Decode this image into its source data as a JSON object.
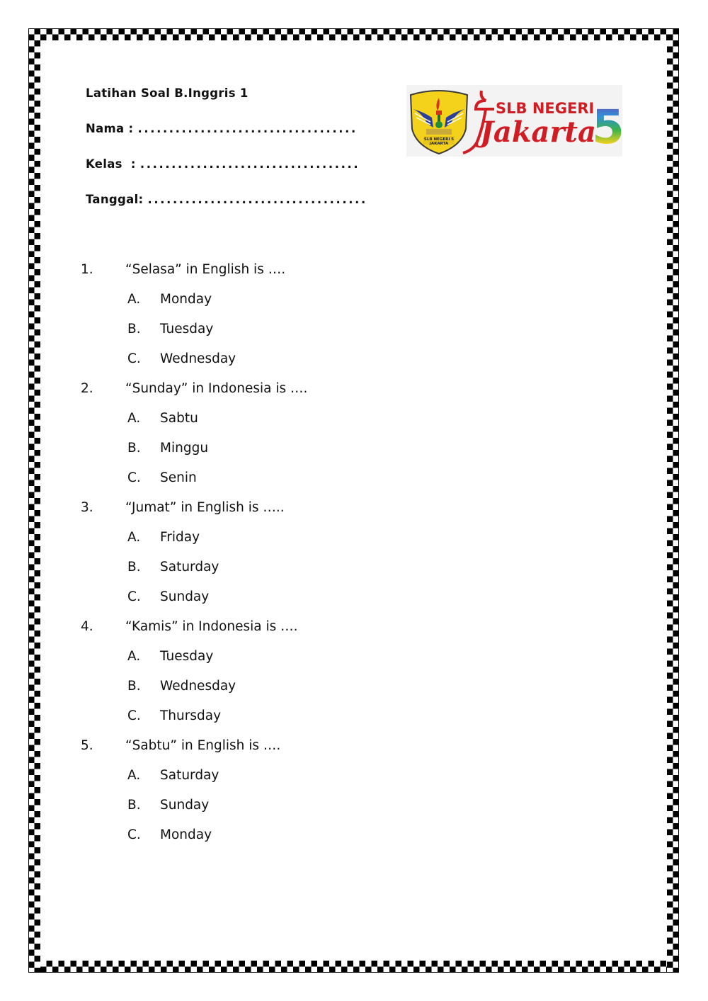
{
  "document": {
    "title": "Latihan Soal B.Inggris 1",
    "fields": [
      {
        "label": "Nama :",
        "blank": "..................................."
      },
      {
        "label": "Kelas  :",
        "blank": "..................................."
      },
      {
        "label": "Tanggal:",
        "blank": "..................................."
      }
    ],
    "logo": {
      "line1": "SLB NEGERI",
      "line2": "Jakarta",
      "number": "5",
      "shield_text": [
        "SLB NEGERI 5",
        "JAKARTA"
      ],
      "colors": {
        "red": "#d01c23",
        "shield_yellow": "#f4d21c",
        "wing_blue": "#2a3f9a"
      }
    }
  },
  "questions": [
    {
      "number": "1.",
      "text": "“Selasa” in English is ….",
      "options": [
        {
          "letter": "A.",
          "text": "Monday"
        },
        {
          "letter": "B.",
          "text": "Tuesday"
        },
        {
          "letter": "C.",
          "text": "Wednesday"
        }
      ]
    },
    {
      "number": "2.",
      "text": "“Sunday” in Indonesia is ….",
      "options": [
        {
          "letter": "A.",
          "text": "Sabtu"
        },
        {
          "letter": "B.",
          "text": "Minggu"
        },
        {
          "letter": "C.",
          "text": "Senin"
        }
      ]
    },
    {
      "number": "3.",
      "text": "“Jumat” in English is …..",
      "options": [
        {
          "letter": "A.",
          "text": "Friday"
        },
        {
          "letter": "B.",
          "text": "Saturday"
        },
        {
          "letter": "C.",
          "text": "Sunday"
        }
      ]
    },
    {
      "number": "4.",
      "text": "“Kamis” in Indonesia is ….",
      "options": [
        {
          "letter": "A.",
          "text": "Tuesday"
        },
        {
          "letter": "B.",
          "text": "Wednesday"
        },
        {
          "letter": "C.",
          "text": "Thursday"
        }
      ]
    },
    {
      "number": "5.",
      "text": "“Sabtu” in English is ….",
      "options": [
        {
          "letter": "A.",
          "text": "Saturday"
        },
        {
          "letter": "B.",
          "text": "Sunday"
        },
        {
          "letter": "C.",
          "text": "Monday"
        }
      ]
    }
  ]
}
